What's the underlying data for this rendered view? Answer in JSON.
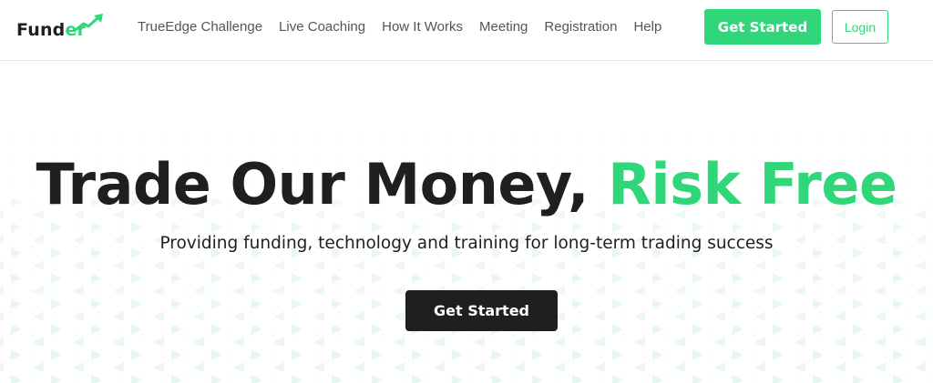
{
  "brand": {
    "logo_text_main": "Fund",
    "logo_text_accent": "er",
    "accent_color": "#2fd67a",
    "dark_color": "#1f1f1f"
  },
  "nav": {
    "items": [
      "TrueEdge Challenge",
      "Live Coaching",
      "How It Works",
      "Meeting",
      "Registration",
      "Help"
    ]
  },
  "header": {
    "cta_label": "Get Started",
    "login_label": "Login"
  },
  "hero": {
    "title_main": "Trade Our Money, ",
    "title_accent": "Risk Free",
    "subtitle": "Providing funding, technology and training for long-term trading success",
    "cta_label": "Get Started"
  },
  "icons": {
    "logo_arrow": "trend-up-arrow-icon"
  }
}
